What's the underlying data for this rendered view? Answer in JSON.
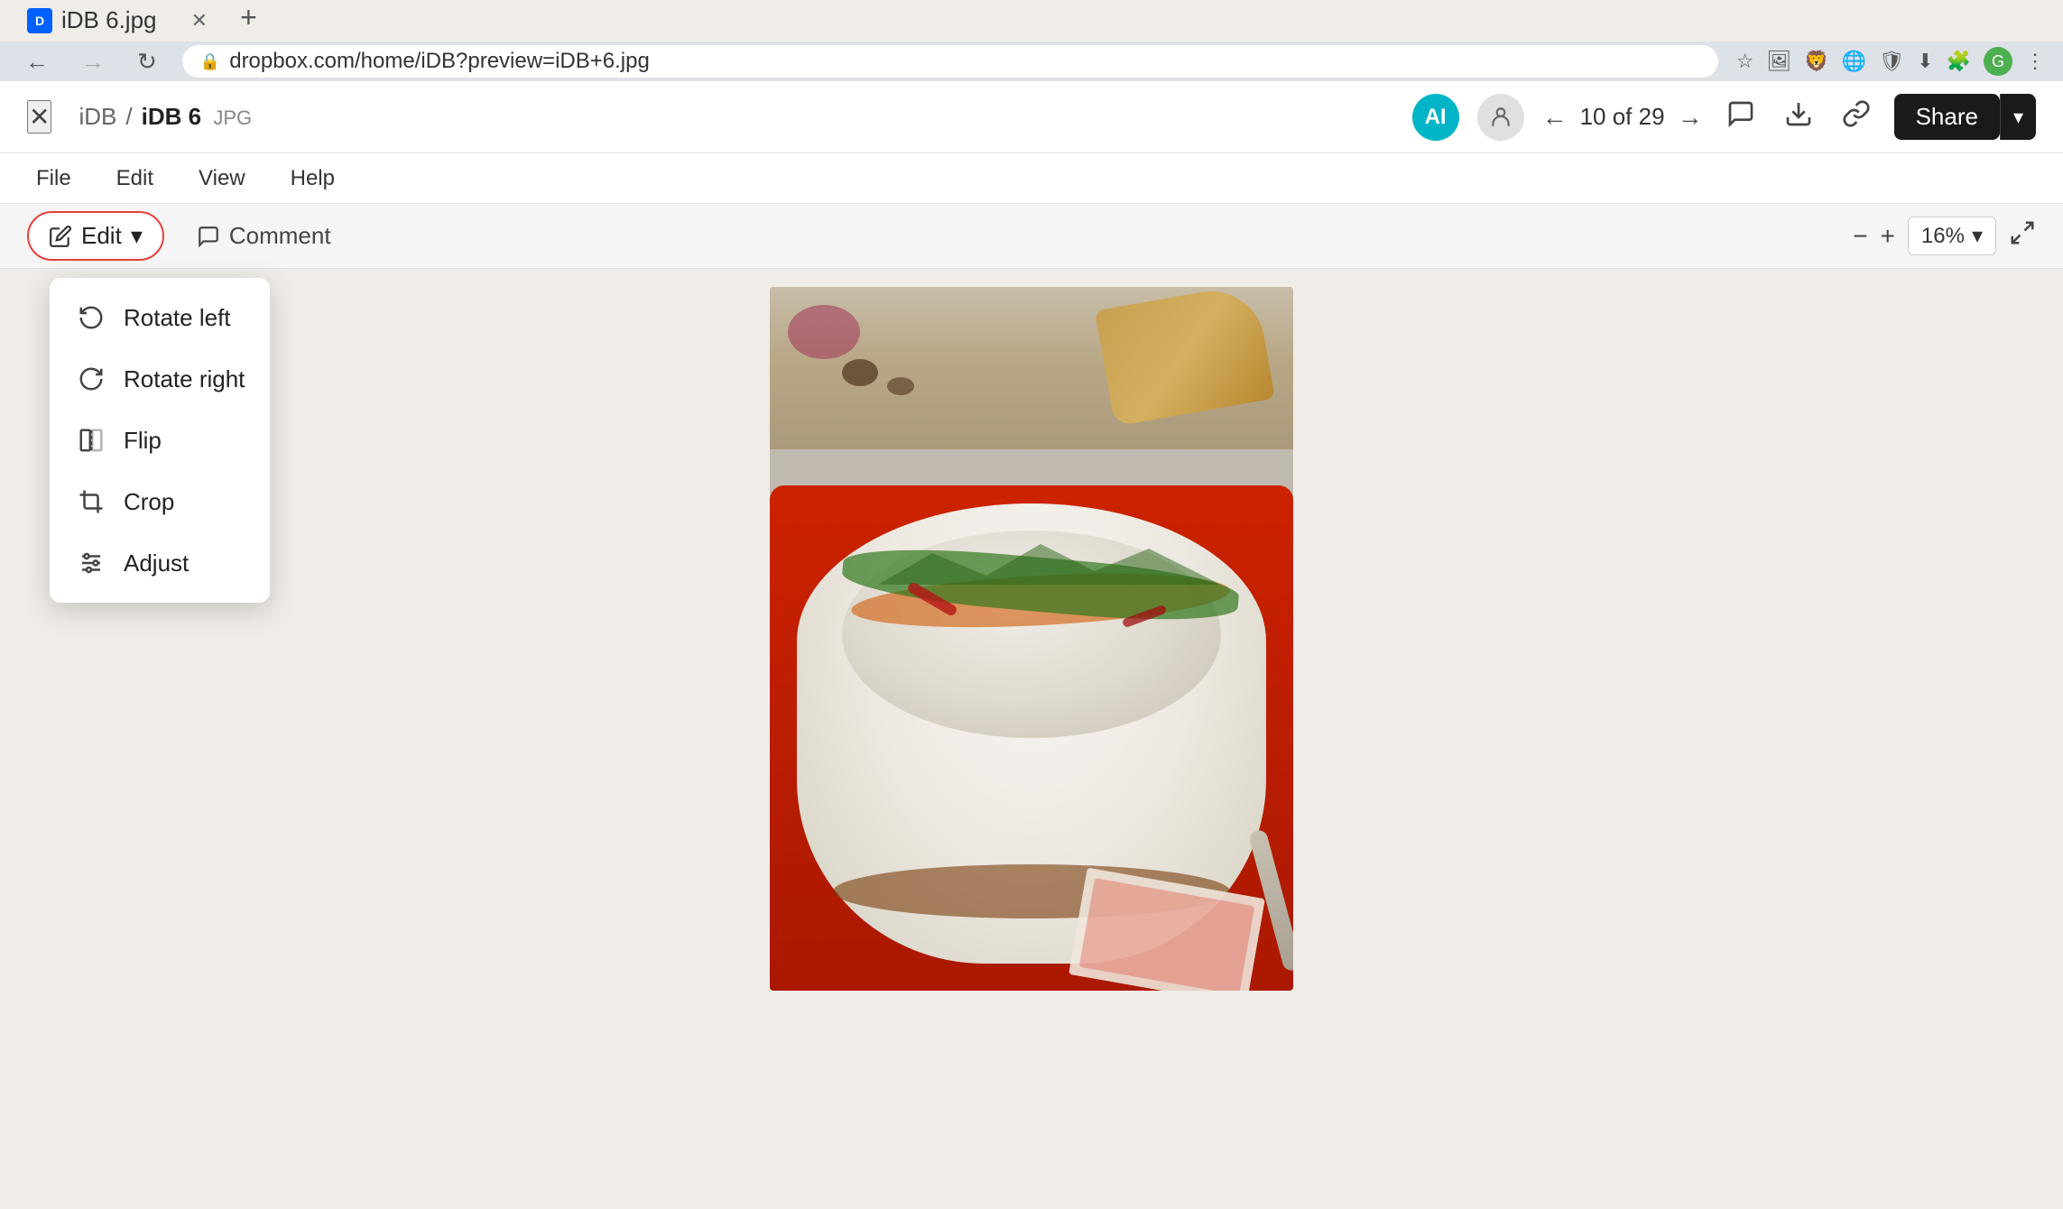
{
  "browser": {
    "tab_title": "iDB 6.jpg",
    "tab_favicon_text": "D",
    "url": "dropbox.com/home/iDB?preview=iDB+6.jpg",
    "new_tab_label": "+"
  },
  "header": {
    "breadcrumb_parent": "iDB",
    "breadcrumb_separator": "/",
    "breadcrumb_current": "iDB 6",
    "breadcrumb_ext": "JPG",
    "avatar_initials": "AI",
    "nav_counter": "10 of 29",
    "share_label": "Share"
  },
  "menu_bar": {
    "items": [
      "File",
      "Edit",
      "View",
      "Help"
    ]
  },
  "toolbar": {
    "edit_label": "Edit",
    "comment_label": "Comment",
    "zoom_value": "16%"
  },
  "dropdown": {
    "items": [
      {
        "id": "rotate-left",
        "label": "Rotate left",
        "icon": "rotate-left-icon"
      },
      {
        "id": "rotate-right",
        "label": "Rotate right",
        "icon": "rotate-right-icon"
      },
      {
        "id": "flip",
        "label": "Flip",
        "icon": "flip-icon"
      },
      {
        "id": "crop",
        "label": "Crop",
        "icon": "crop-icon"
      },
      {
        "id": "adjust",
        "label": "Adjust",
        "icon": "adjust-icon"
      }
    ]
  },
  "colors": {
    "edit_border": "#e53e3e",
    "share_bg": "#1a1a1a",
    "avatar_bg": "#00b5c8",
    "dropdown_shadow": "rgba(0,0,0,0.18)"
  }
}
